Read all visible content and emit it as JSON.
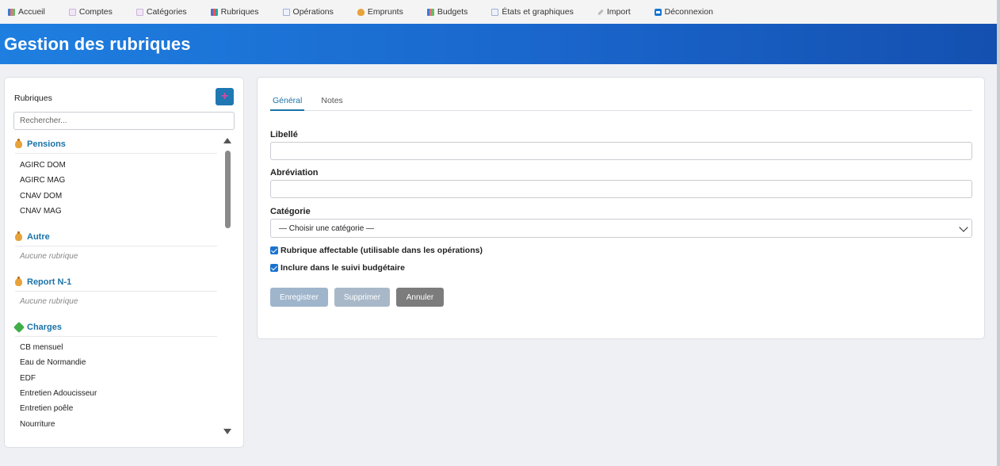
{
  "nav": {
    "items": [
      {
        "label": "Accueil",
        "icon": "chart-icon"
      },
      {
        "label": "Comptes",
        "icon": "memo-icon"
      },
      {
        "label": "Catégories",
        "icon": "memo-icon"
      },
      {
        "label": "Rubriques",
        "icon": "books-icon"
      },
      {
        "label": "Opérations",
        "icon": "line-chart-icon"
      },
      {
        "label": "Emprunts",
        "icon": "money-bag-icon"
      },
      {
        "label": "Budgets",
        "icon": "chart-icon"
      },
      {
        "label": "États et graphiques",
        "icon": "line-chart-icon"
      },
      {
        "label": "Import",
        "icon": "wrench-icon"
      },
      {
        "label": "Déconnexion",
        "icon": "arrow-right-icon"
      }
    ]
  },
  "header": {
    "title": "Gestion des rubriques"
  },
  "sidebar": {
    "title": "Rubriques",
    "add_label": "+",
    "search_placeholder": "Rechercher...",
    "groups": [
      {
        "name": "Pensions",
        "icon": "money-bag-icon",
        "items": [
          "AGIRC DOM",
          "AGIRC MAG",
          "CNAV DOM",
          "CNAV MAG"
        ]
      },
      {
        "name": "Autre",
        "icon": "money-bag-icon",
        "empty_label": "Aucune rubrique"
      },
      {
        "name": "Report N-1",
        "icon": "money-bag-icon",
        "empty_label": "Aucune rubrique"
      },
      {
        "name": "Charges",
        "icon": "money-icon",
        "items": [
          "CB mensuel",
          "Eau de Normandie",
          "EDF",
          "Entretien Adoucisseur",
          "Entretien poêle",
          "Nourriture"
        ]
      }
    ]
  },
  "form": {
    "tabs": [
      {
        "label": "Général"
      },
      {
        "label": "Notes"
      }
    ],
    "libelle_label": "Libellé",
    "libelle_value": "",
    "abreviation_label": "Abréviation",
    "abreviation_value": "",
    "categorie_label": "Catégorie",
    "categorie_selected": "— Choisir une catégorie —",
    "check_affectable": "Rubrique affectable (utilisable dans les opérations)",
    "check_budget": "Inclure dans le suivi budgétaire",
    "save_label": "Enregistrer",
    "delete_label": "Supprimer",
    "cancel_label": "Annuler"
  },
  "colors": {
    "accent": "#1a73a8",
    "header_start": "#1e7fe0",
    "header_end": "#1450b0"
  }
}
